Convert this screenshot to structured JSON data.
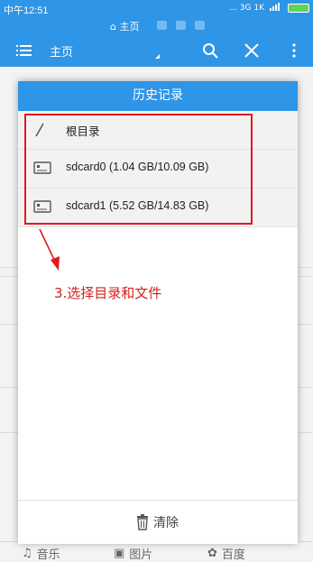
{
  "status_bar": {
    "time": "中午12:51",
    "indicators": "... 3G 1K"
  },
  "tabstrip": {
    "active_tab": "主页",
    "home_icon": "home-icon"
  },
  "toolbar": {
    "title": "主页"
  },
  "dialog": {
    "title": "历史记录",
    "items": [
      {
        "label": "根目录",
        "icon": "slash-icon"
      },
      {
        "label": "sdcard0 (1.04 GB/10.09 GB)",
        "icon": "sdcard-icon"
      },
      {
        "label": "sdcard1 (5.52 GB/14.83 GB)",
        "icon": "sdcard-icon"
      }
    ],
    "clear_label": "清除"
  },
  "annotation": {
    "text": "3.选择目录和文件"
  },
  "bottom_nav": {
    "items": [
      "音乐",
      "图片",
      "百度"
    ]
  },
  "colors": {
    "accent": "#2f95e6",
    "annotation": "#e0191d"
  }
}
